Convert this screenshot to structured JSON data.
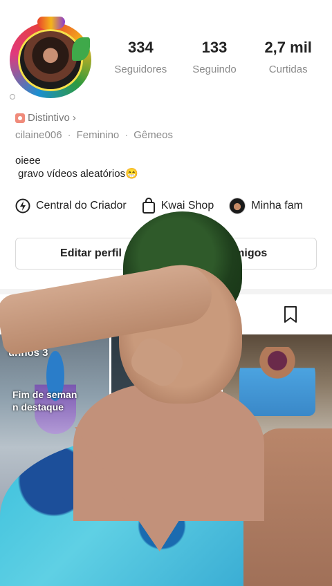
{
  "profile": {
    "stats": [
      {
        "value": "334",
        "label": "Seguidores"
      },
      {
        "value": "133",
        "label": "Seguindo"
      },
      {
        "value": "2,7 mil",
        "label": "Curtidas"
      }
    ],
    "badge_label": "Distintivo",
    "badge_chevron": "›",
    "username": "cilaine006",
    "gender": "Feminino",
    "sign": "Gêmeos",
    "separator": "·",
    "bio_line1": "oieee",
    "bio_line2": "gravo vídeos aleatórios😁"
  },
  "tools": {
    "creator_center": "Central do Criador",
    "creator_center_icon": "lightning-icon",
    "kwai_shop": "Kwai Shop",
    "kwai_shop_icon": "shopping-bag-icon",
    "family": "Minha fam"
  },
  "actions": {
    "edit_profile": "Editar perfil",
    "add_friends": "ar amigos"
  },
  "tabs": {
    "videos_icon": "video-grid-icon",
    "saved_icon": "bookmark-icon"
  },
  "grid": {
    "thumb1_label": "unnos 3",
    "thumb1_caption_line1": "Fim de seman",
    "thumb1_caption_line2": "n destaque"
  },
  "colors": {
    "text": "#222222",
    "muted": "#8a8a8a",
    "border": "#dadada",
    "badge": "#f08b7b"
  }
}
